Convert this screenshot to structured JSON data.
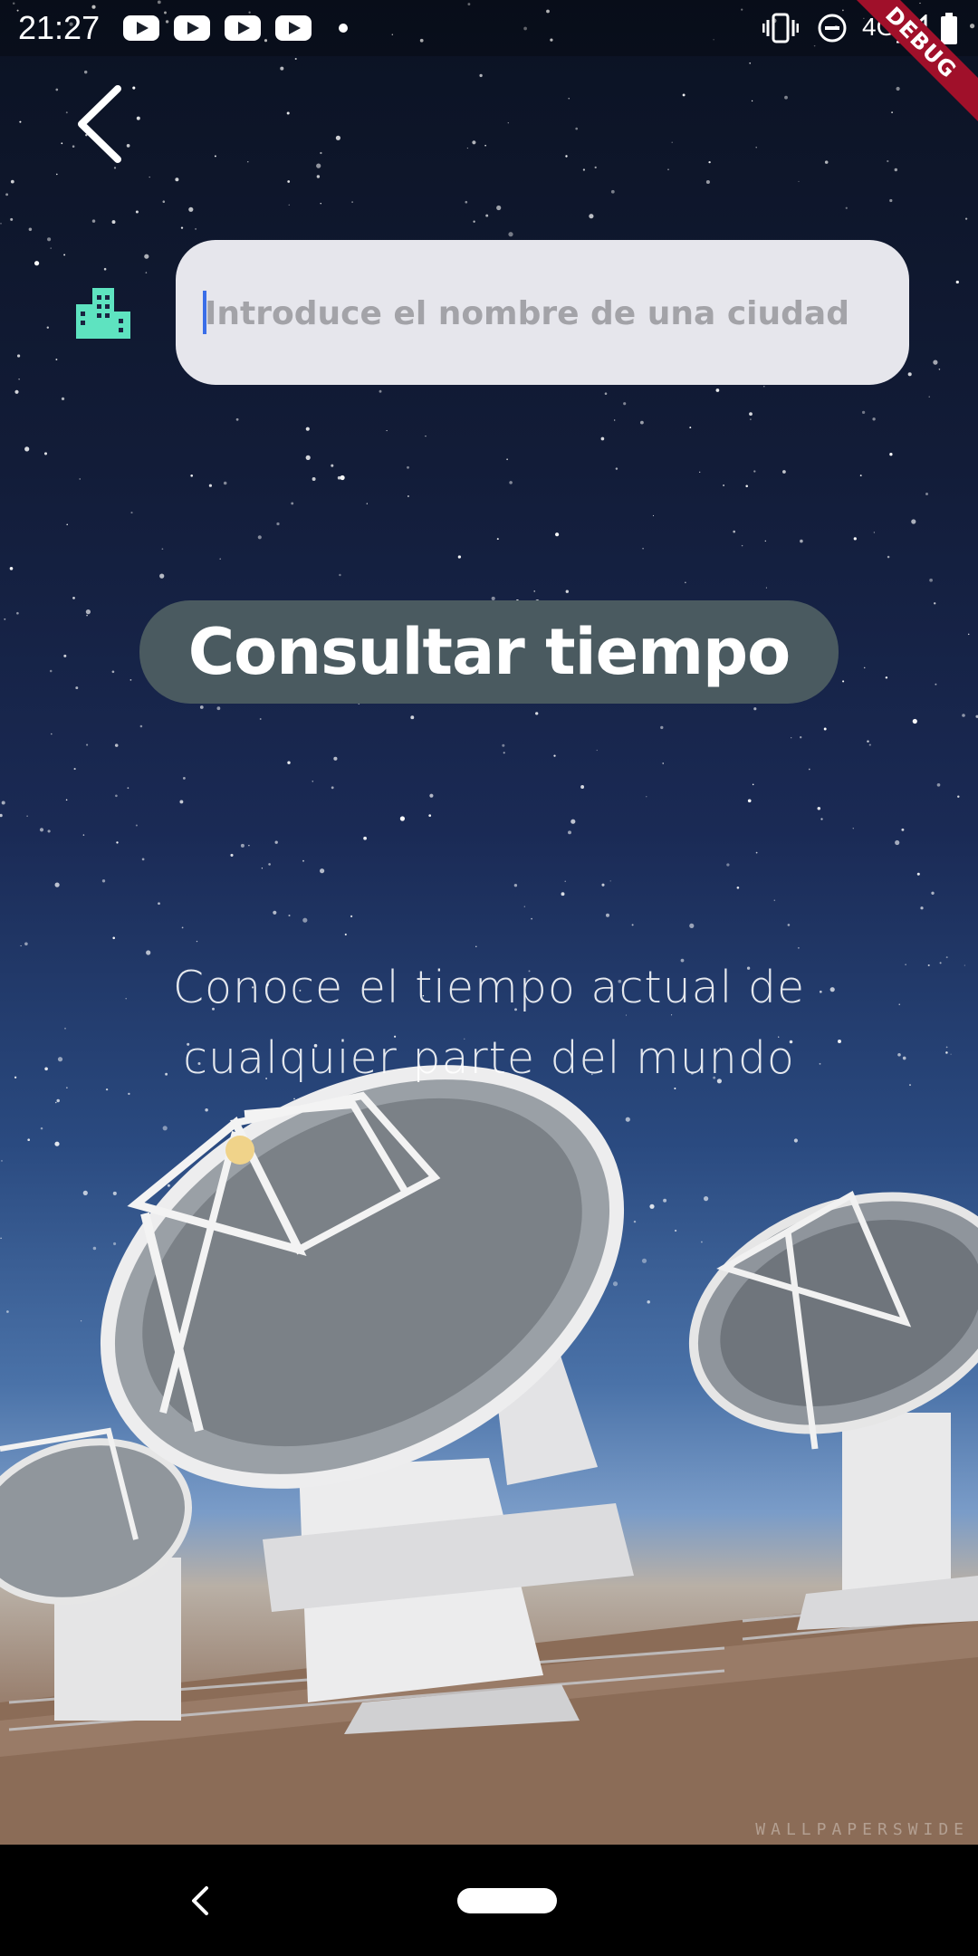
{
  "status_bar": {
    "time": "21:27",
    "network": "4G",
    "notification_icons": [
      "youtube-icon",
      "youtube-icon",
      "youtube-icon",
      "youtube-icon"
    ]
  },
  "debug_banner": "DEBUG",
  "search": {
    "placeholder": "Introduce el nombre de una ciudad",
    "value": "",
    "leading_icon": "city-icon"
  },
  "actions": {
    "consult_label": "Consultar tiempo"
  },
  "tagline": {
    "line1": "Conoce el tiempo actual de",
    "line2": "cualquier parte del mundo"
  },
  "background": {
    "watermark": "WALLPAPERSWIDE"
  },
  "colors": {
    "accent_icon": "#5ee3c0",
    "button_bg": "#4a5a60",
    "field_bg": "#e6e6ec",
    "cursor": "#3a6ee8",
    "debug_banner": "#a0102a"
  }
}
